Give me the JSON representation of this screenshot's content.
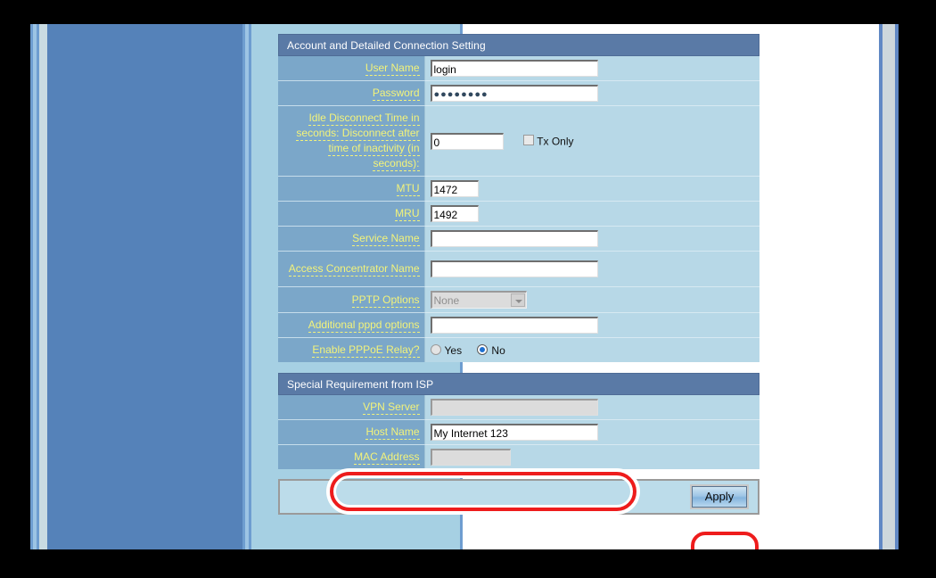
{
  "page": {
    "panels": [
      {
        "title": "Account and Detailed Connection Setting",
        "rows": [
          {
            "label": "User Name",
            "value": "login",
            "control": "text"
          },
          {
            "label": "Password",
            "value": "●●●●●●●●",
            "control": "password"
          },
          {
            "label": "Idle Disconnect Time in seconds: Disconnect after time of inactivity (in seconds):",
            "value": "0",
            "control": "text-with-checkbox",
            "checkbox_label": "Tx Only",
            "checkbox_checked": "false"
          },
          {
            "label": "MTU",
            "value": "1472",
            "control": "text"
          },
          {
            "label": "MRU",
            "value": "1492",
            "control": "text"
          },
          {
            "label": "Service Name",
            "value": "",
            "control": "text"
          },
          {
            "label": "Access Concentrator Name",
            "value": "",
            "control": "text"
          },
          {
            "label": "PPTP Options",
            "value": "None",
            "control": "select-disabled"
          },
          {
            "label": "Additional pppd options",
            "value": "",
            "control": "text"
          },
          {
            "label": "Enable PPPoE Relay?",
            "value": "No",
            "control": "radio",
            "options": [
              "Yes",
              "No"
            ]
          }
        ]
      },
      {
        "title": "Special Requirement from ISP",
        "rows": [
          {
            "label": "VPN Server",
            "value": "",
            "control": "text-disabled"
          },
          {
            "label": "Host Name",
            "value": "My Internet 123",
            "control": "text"
          },
          {
            "label": "MAC Address",
            "value": "",
            "control": "text-disabled"
          }
        ]
      }
    ],
    "apply_label": "Apply"
  },
  "labels": {
    "user_name": "User Name",
    "password": "Password",
    "idle_disconnect": "Idle Disconnect Time in seconds: Disconnect after time of inactivity (in seconds):",
    "mtu": "MTU",
    "mru": "MRU",
    "service_name": "Service Name",
    "access_concentrator_name": "Access Concentrator Name",
    "pptp_options": "PPTP Options",
    "additional_pppd_options": "Additional pppd options",
    "enable_pppoe_relay": "Enable PPPoE Relay?",
    "vpn_server": "VPN Server",
    "host_name": "Host Name",
    "mac_address": "MAC Address",
    "tx_only": "Tx Only",
    "yes": "Yes",
    "no": "No"
  },
  "values": {
    "user_name": "login",
    "password_masked": "●●●●●●●●",
    "idle_seconds": "0",
    "mtu": "1472",
    "mru": "1492",
    "service_name": "",
    "access_concentrator_name": "",
    "pptp_options": "None",
    "additional_pppd_options": "",
    "vpn_server": "",
    "host_name": "My Internet 123",
    "mac_address": ""
  },
  "titles": {
    "account_panel": "Account and Detailed Connection Setting",
    "isp_panel": "Special Requirement from ISP"
  },
  "buttons": {
    "apply": "Apply"
  },
  "colors": {
    "panel_header": "#5a7aa6",
    "label_cell": "#7ba7c9",
    "label_text": "#f3f37a",
    "value_cell": "#b7d8e7",
    "page_bg": "#a6d0e3",
    "nav_panel": "#5582b9",
    "highlight": "#ee1c1c",
    "radio_selected": "#1d6fd0"
  }
}
